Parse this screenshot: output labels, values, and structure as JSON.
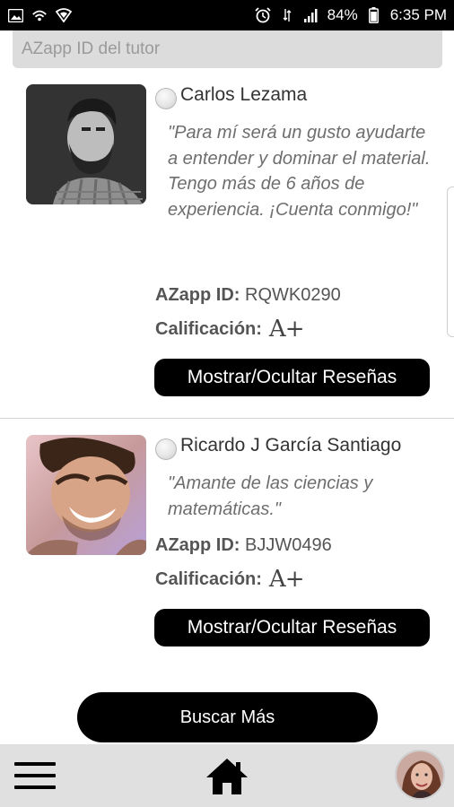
{
  "status_bar": {
    "battery": "84%",
    "time": "6:35 PM",
    "left_icons": [
      "image-icon",
      "hotspot-icon",
      "shield-icon"
    ],
    "right_icons": [
      "alarm-icon",
      "data-icon",
      "signal-icon",
      "battery-icon"
    ]
  },
  "search": {
    "placeholder": "AZapp ID del tutor",
    "value": ""
  },
  "labels": {
    "id_label": "AZapp ID:",
    "rating_label": "Calificación:",
    "reviews_button": "Mostrar/Ocultar Reseñas",
    "search_more": "Buscar Más"
  },
  "tutors": [
    {
      "name": "Carlos Lezama",
      "quote": "\"Para mí será un gusto ayudarte a entender y dominar el material. Tengo más de 6 años de experiencia. ¡Cuenta conmigo!\"",
      "azapp_id": "RQWK0290",
      "rating": "A+",
      "selected": false
    },
    {
      "name": "Ricardo J García Santiago",
      "quote": "\"Amante de las ciencias y matemáticas.\"",
      "azapp_id": "BJJW0496",
      "rating": "A+",
      "selected": false
    }
  ],
  "nav": {
    "icons": [
      "menu-icon",
      "home-icon",
      "profile-avatar"
    ]
  },
  "colors": {
    "primary_button": "#000000",
    "nav_background": "#e0e0e0",
    "input_background": "#dcdcdc",
    "status_bar": "#000000"
  }
}
